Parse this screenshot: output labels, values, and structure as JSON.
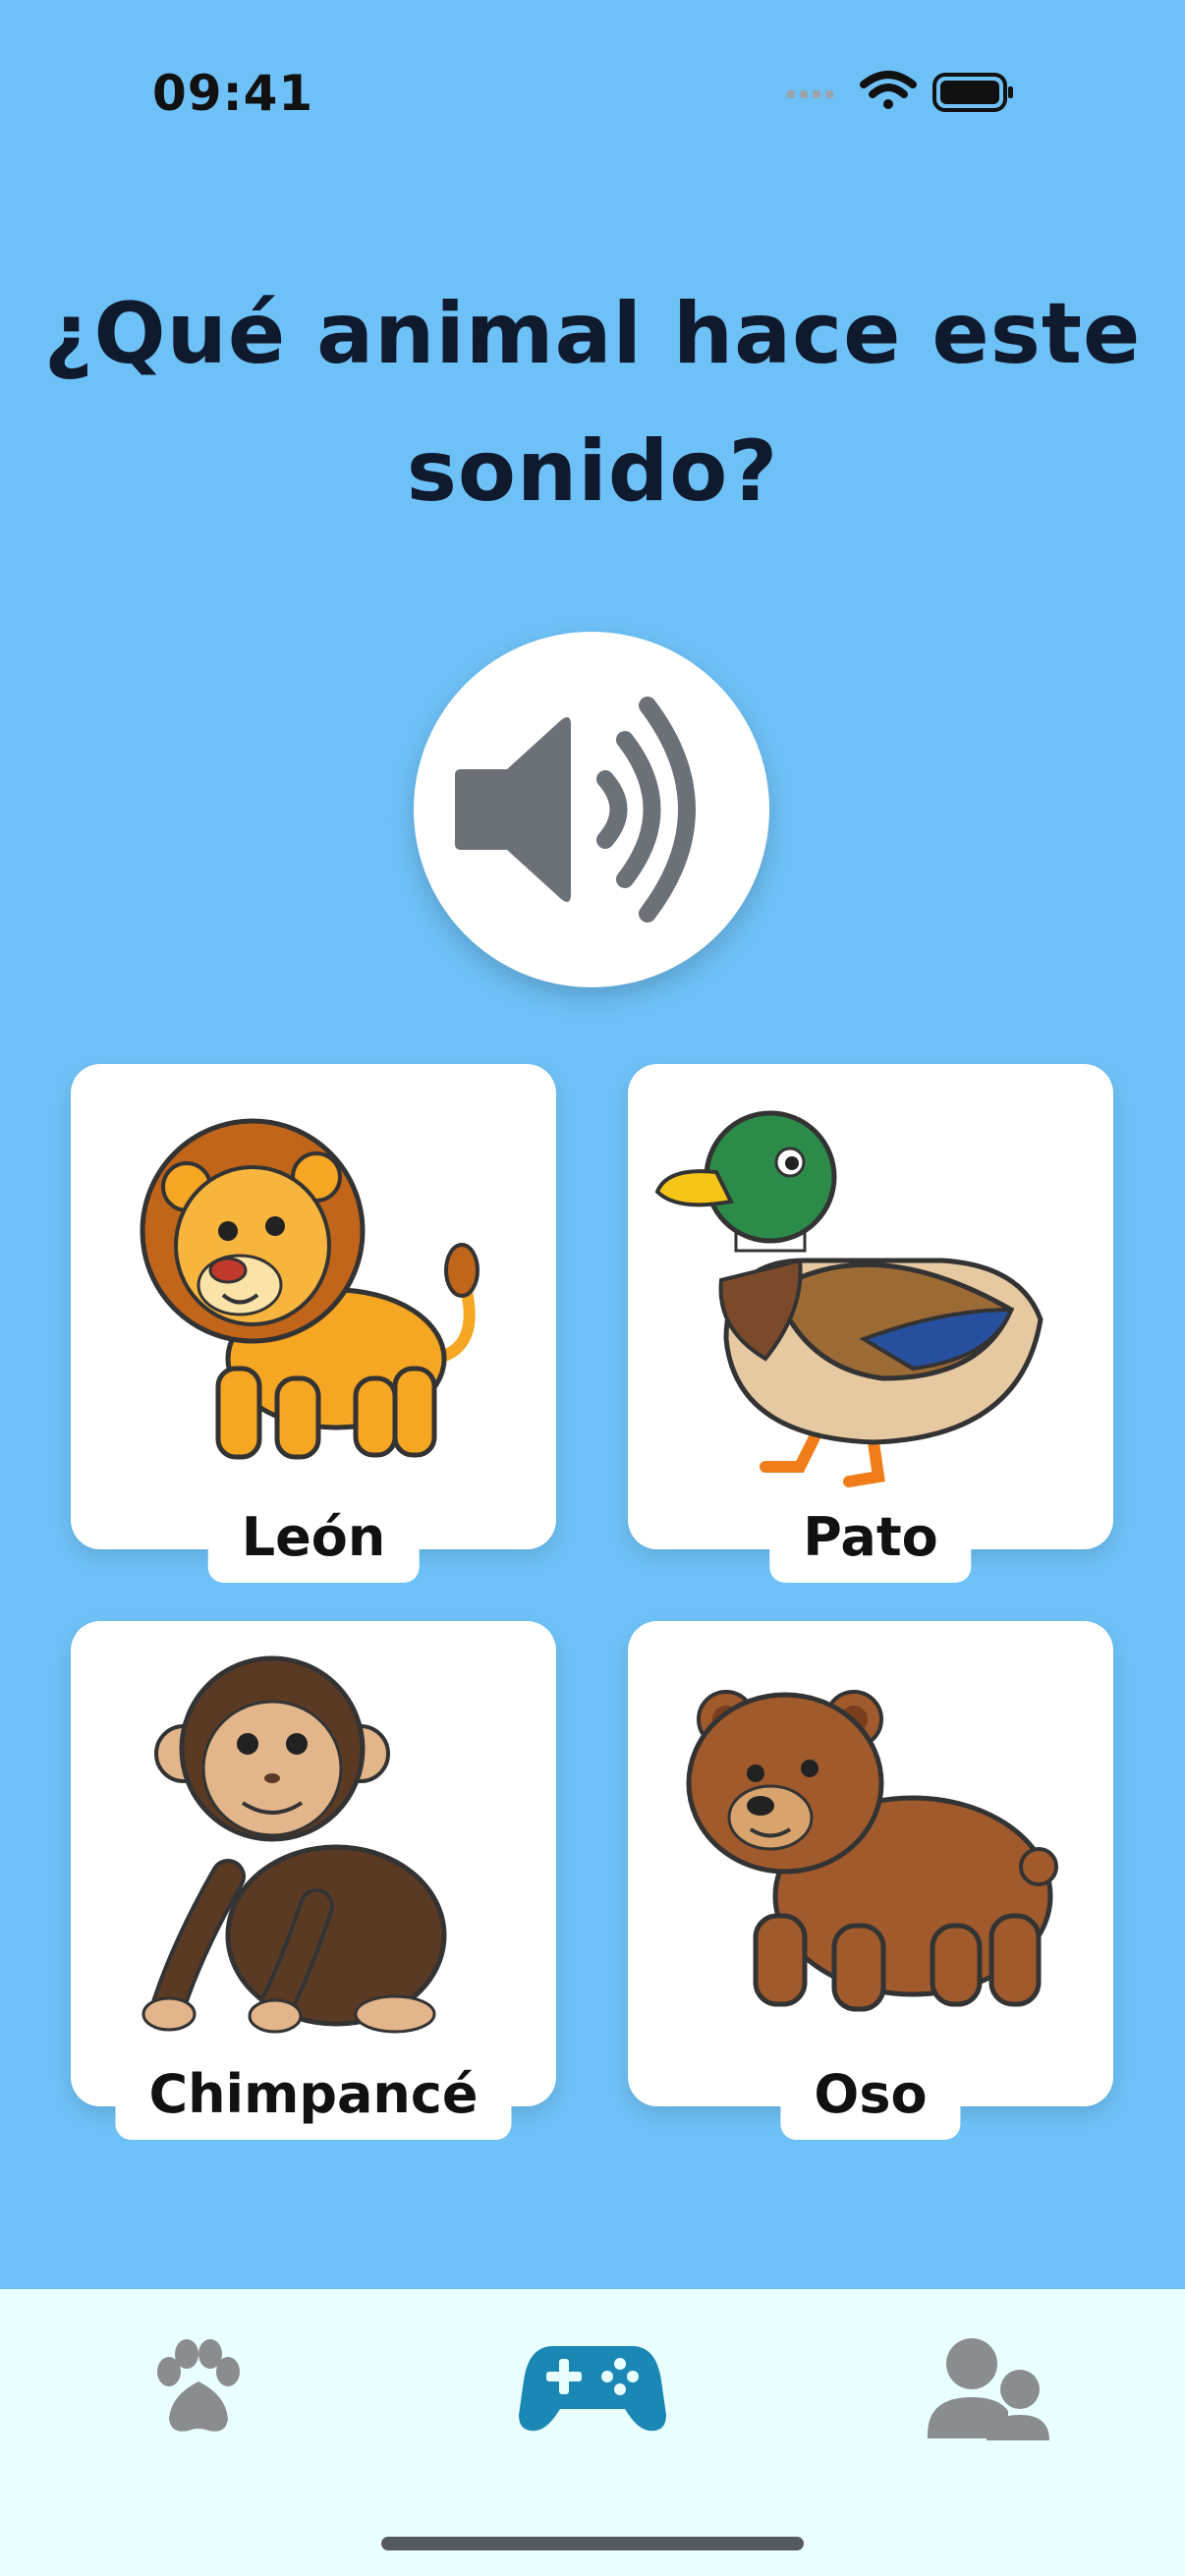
{
  "status_bar": {
    "time": "09:41",
    "icons": [
      "signal-dots-icon",
      "wifi-icon",
      "battery-icon"
    ]
  },
  "question": {
    "title": "¿Qué animal hace este sonido?"
  },
  "play_sound": {
    "icon": "speaker-icon"
  },
  "options": [
    {
      "label": "León",
      "image": "lion"
    },
    {
      "label": "Pato",
      "image": "duck"
    },
    {
      "label": "Chimpancé",
      "image": "chimpanzee"
    },
    {
      "label": "Oso",
      "image": "bear"
    }
  ],
  "tab_bar": {
    "tabs": [
      {
        "icon": "paw-icon",
        "active": false
      },
      {
        "icon": "gamepad-icon",
        "active": true
      },
      {
        "icon": "users-icon",
        "active": false
      }
    ]
  },
  "colors": {
    "background": "#6ec1f7",
    "tab_bar": "#eaffff",
    "active_tab": "#1a87b5",
    "inactive_tab": "#8a8d90"
  }
}
